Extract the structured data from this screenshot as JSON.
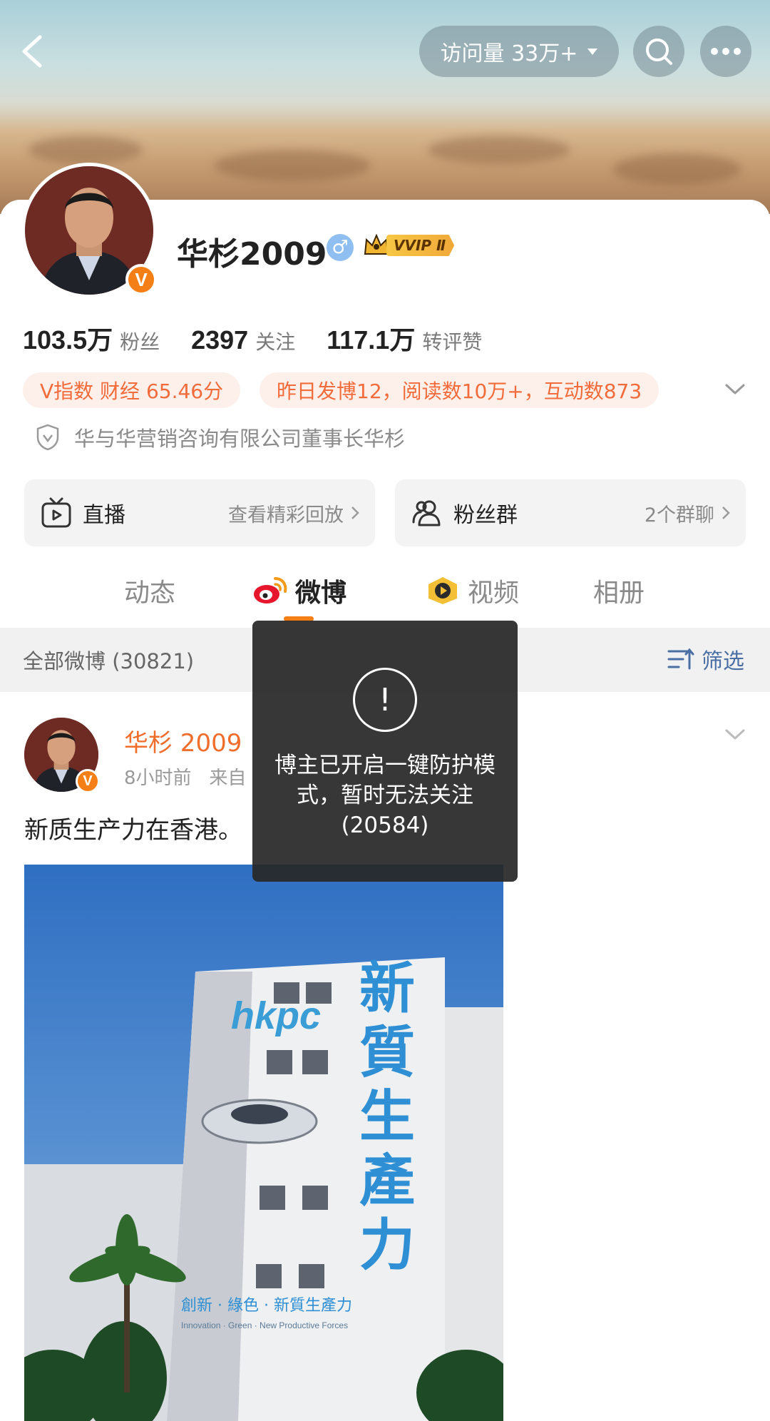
{
  "header": {
    "visits_label": "访问量 33万+"
  },
  "profile": {
    "username": "华杉2009",
    "gender": "♂",
    "vip_label": "VVIP Ⅱ",
    "verified_badge": "V",
    "stats": [
      {
        "value": "103.5万",
        "label": "粉丝"
      },
      {
        "value": "2397",
        "label": "关注"
      },
      {
        "value": "117.1万",
        "label": "转评赞"
      }
    ],
    "chips": {
      "v_index": "V指数 财经 65.46分",
      "yesterday": "昨日发博12，阅读数10万+，互动数873"
    },
    "company": "华与华营销咨询有限公司董事长华杉",
    "features": {
      "live_label": "直播",
      "live_sub": "查看精彩回放",
      "fans_label": "粉丝群",
      "fans_sub": "2个群聊"
    }
  },
  "tabs": [
    {
      "label": "动态",
      "icon": null
    },
    {
      "label": "微博",
      "icon": "weibo-icon"
    },
    {
      "label": "视频",
      "icon": "video-icon"
    },
    {
      "label": "相册",
      "icon": null
    }
  ],
  "active_tab": 1,
  "filter_bar": {
    "count_label": "全部微博 (30821)",
    "filter_label": "筛选"
  },
  "post": {
    "author": "华杉 2009",
    "time": "8小时前",
    "source_prefix": "来自",
    "text": "新质生产力在香港。",
    "image": {
      "logo_text": "hkpc",
      "vertical_text": [
        "新",
        "質",
        "生",
        "產",
        "力"
      ],
      "slogan": "創新 · 綠色 · 新質生產力",
      "slogan_en": "Innovation · Green · New Productive Forces"
    }
  },
  "toast": {
    "message": "博主已开启一键防护模式，暂时无法关注",
    "code": "(20584)"
  },
  "colors": {
    "accent_orange": "#f57f17",
    "link_blue": "#4a6fa5",
    "chip_text": "#f26b3a"
  }
}
